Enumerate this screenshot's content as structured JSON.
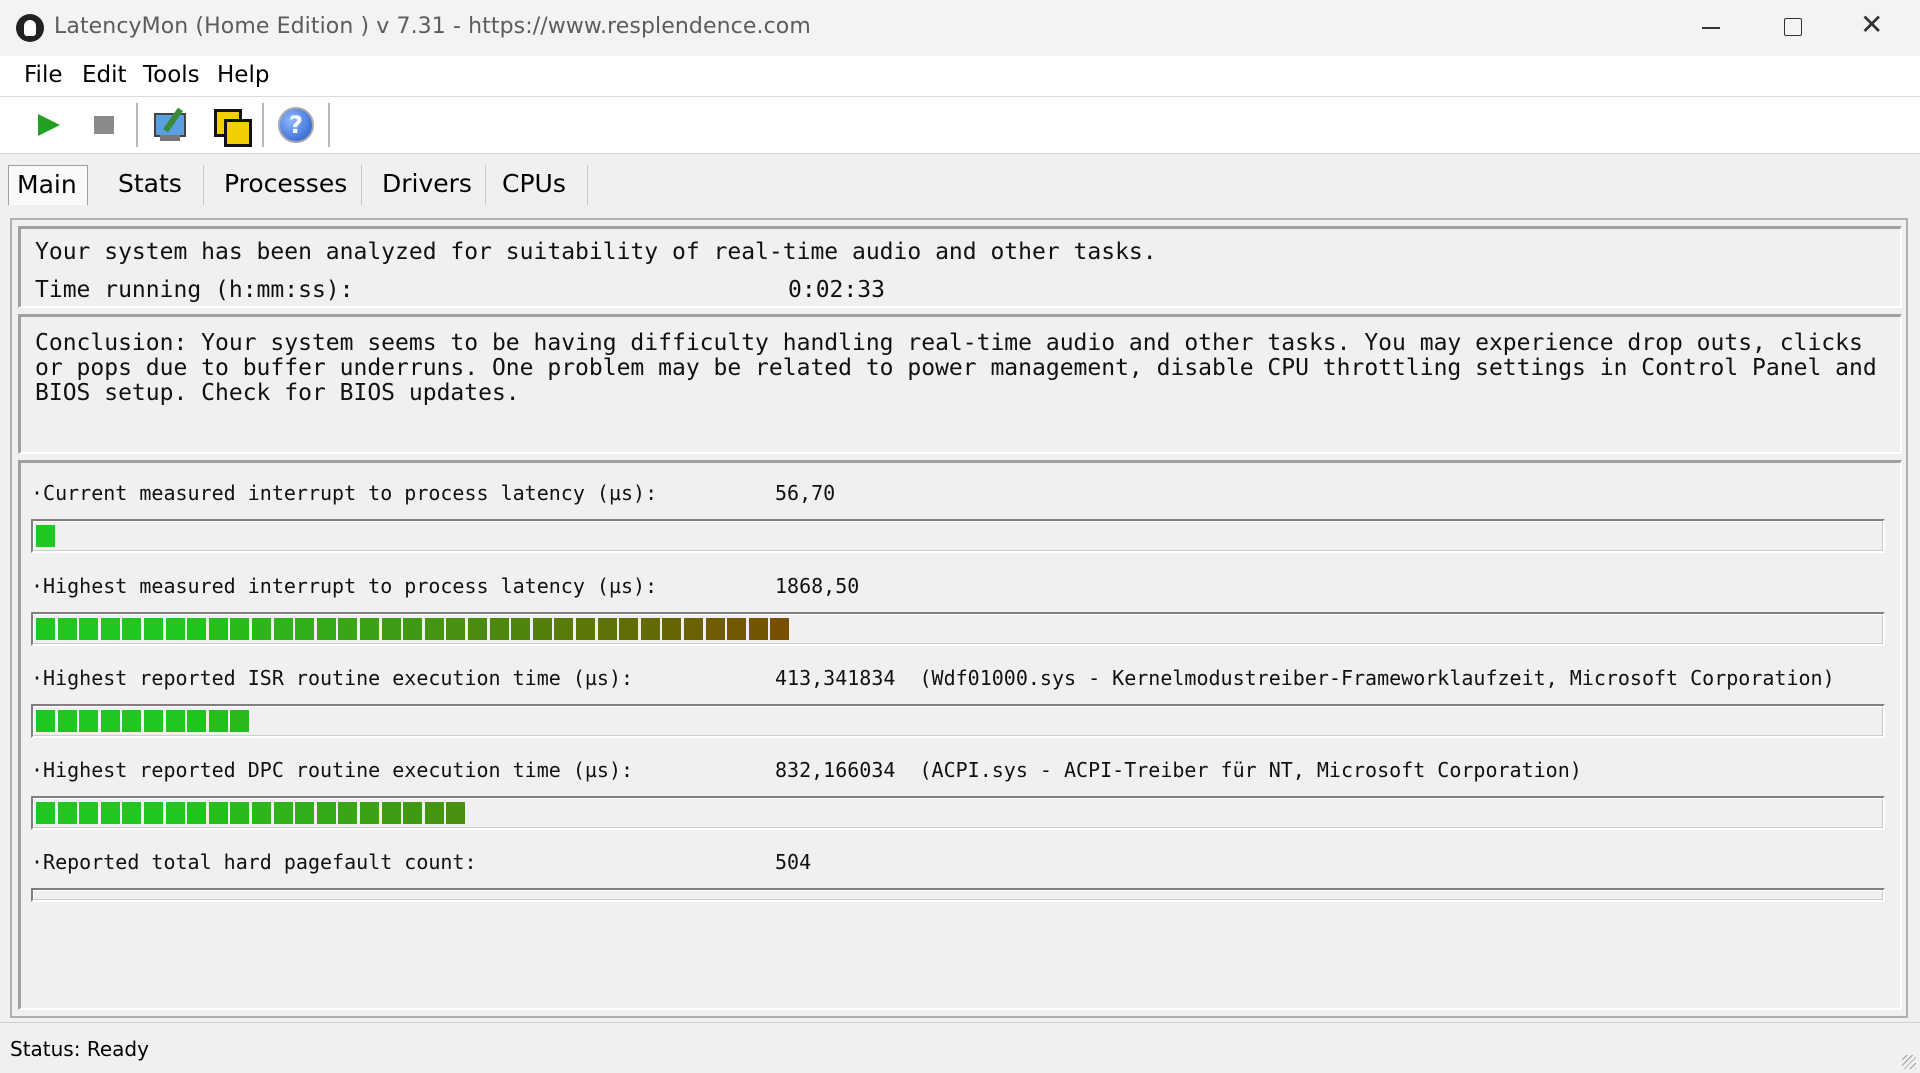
{
  "window": {
    "title": "LatencyMon  (Home Edition )  v 7.31 - https://www.resplendence.com",
    "controls": {
      "minimize": "─",
      "maximize": "☐",
      "close": "✕"
    }
  },
  "menu": {
    "items": [
      "File",
      "Edit",
      "Tools",
      "Help"
    ]
  },
  "toolbar": {
    "buttons": [
      "play-icon",
      "stop-icon",
      "process-tool-icon",
      "copy-icon",
      "help-icon"
    ],
    "help_glyph": "?"
  },
  "tabs": [
    "Main",
    "Stats",
    "Processes",
    "Drivers",
    "CPUs"
  ],
  "main": {
    "analysis_line": "Your system has been analyzed for suitability of real-time audio and other tasks.",
    "time_label": "Time running (h:mm:ss):",
    "time_value": "0:02:33",
    "conclusion": "Conclusion: Your system seems to be having difficulty handling real-time audio and other tasks. You may experience drop outs, clicks or pops due to buffer underruns. One problem may be related to power management, disable CPU throttling settings in Control Panel and BIOS setup. Check for BIOS updates.",
    "metrics": [
      {
        "label": "·Current measured interrupt to process latency (µs):",
        "value": "56,70",
        "detail": "",
        "segments": 1
      },
      {
        "label": "·Highest measured interrupt to process latency (µs):",
        "value": "1868,50",
        "detail": "",
        "segments": 35
      },
      {
        "label": "·Highest reported ISR routine execution time (µs):",
        "value": "413,341834",
        "detail": "(Wdf01000.sys - Kernelmodustreiber-Frameworklaufzeit, Microsoft Corporation)",
        "segments": 10
      },
      {
        "label": "·Highest reported DPC routine execution time (µs):",
        "value": "832,166034",
        "detail": "(ACPI.sys - ACPI-Treiber für NT, Microsoft Corporation)",
        "segments": 20
      },
      {
        "label": "·Reported total hard pagefault count:",
        "value": "504",
        "detail": "",
        "segments": 0
      }
    ]
  },
  "status": {
    "text": "Status: Ready"
  },
  "colors": {
    "meter_green": "#1ec81e",
    "meter_dark": "#7a4d00",
    "accent_blue": "#1f56c9"
  }
}
